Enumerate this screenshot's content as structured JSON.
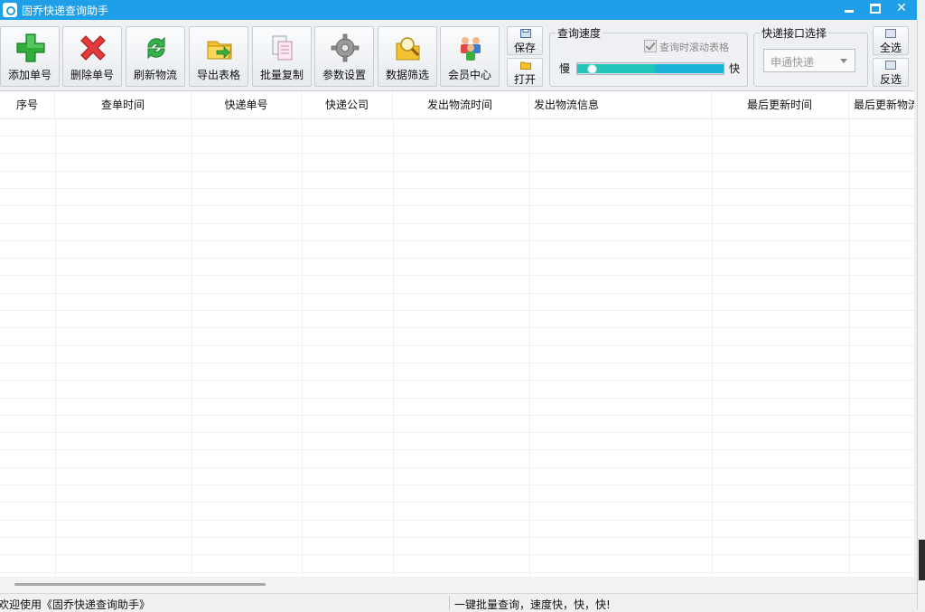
{
  "window": {
    "title": "固乔快递查询助手"
  },
  "toolbar": {
    "buttons": [
      {
        "label": "添加单号",
        "icon": "plus-icon"
      },
      {
        "label": "删除单号",
        "icon": "delete-icon"
      },
      {
        "label": "刷新物流",
        "icon": "refresh-icon"
      },
      {
        "label": "导出表格",
        "icon": "export-folder-icon"
      },
      {
        "label": "批量复制",
        "icon": "copy-icon"
      },
      {
        "label": "参数设置",
        "icon": "gear-icon"
      },
      {
        "label": "数据筛选",
        "icon": "filter-search-icon"
      },
      {
        "label": "会员中心",
        "icon": "members-icon"
      }
    ],
    "save_label": "保存",
    "open_label": "打开",
    "speed": {
      "group_title": "查询速度",
      "scroll_checkbox_label": "查询时滚动表格",
      "scroll_checked": true,
      "slow_label": "慢",
      "fast_label": "快",
      "level": 0.05
    },
    "api": {
      "group_title": "快递接口选择",
      "selected": "申通快递"
    },
    "select_all_label": "全选",
    "invert_label": "反选"
  },
  "table": {
    "columns": [
      "序号",
      "查单时间",
      "快递单号",
      "快递公司",
      "发出物流时间",
      "发出物流信息",
      "最后更新时间",
      "最后更新物流"
    ],
    "rows": []
  },
  "status": {
    "left": "欢迎使用《固乔快递查询助手》",
    "right": "一键批量查询，速度快，快，快!"
  },
  "colors": {
    "titlebar": "#1e9fe8",
    "slider_fill": "#22c5ba",
    "slider_track": "#1ab0d8"
  }
}
